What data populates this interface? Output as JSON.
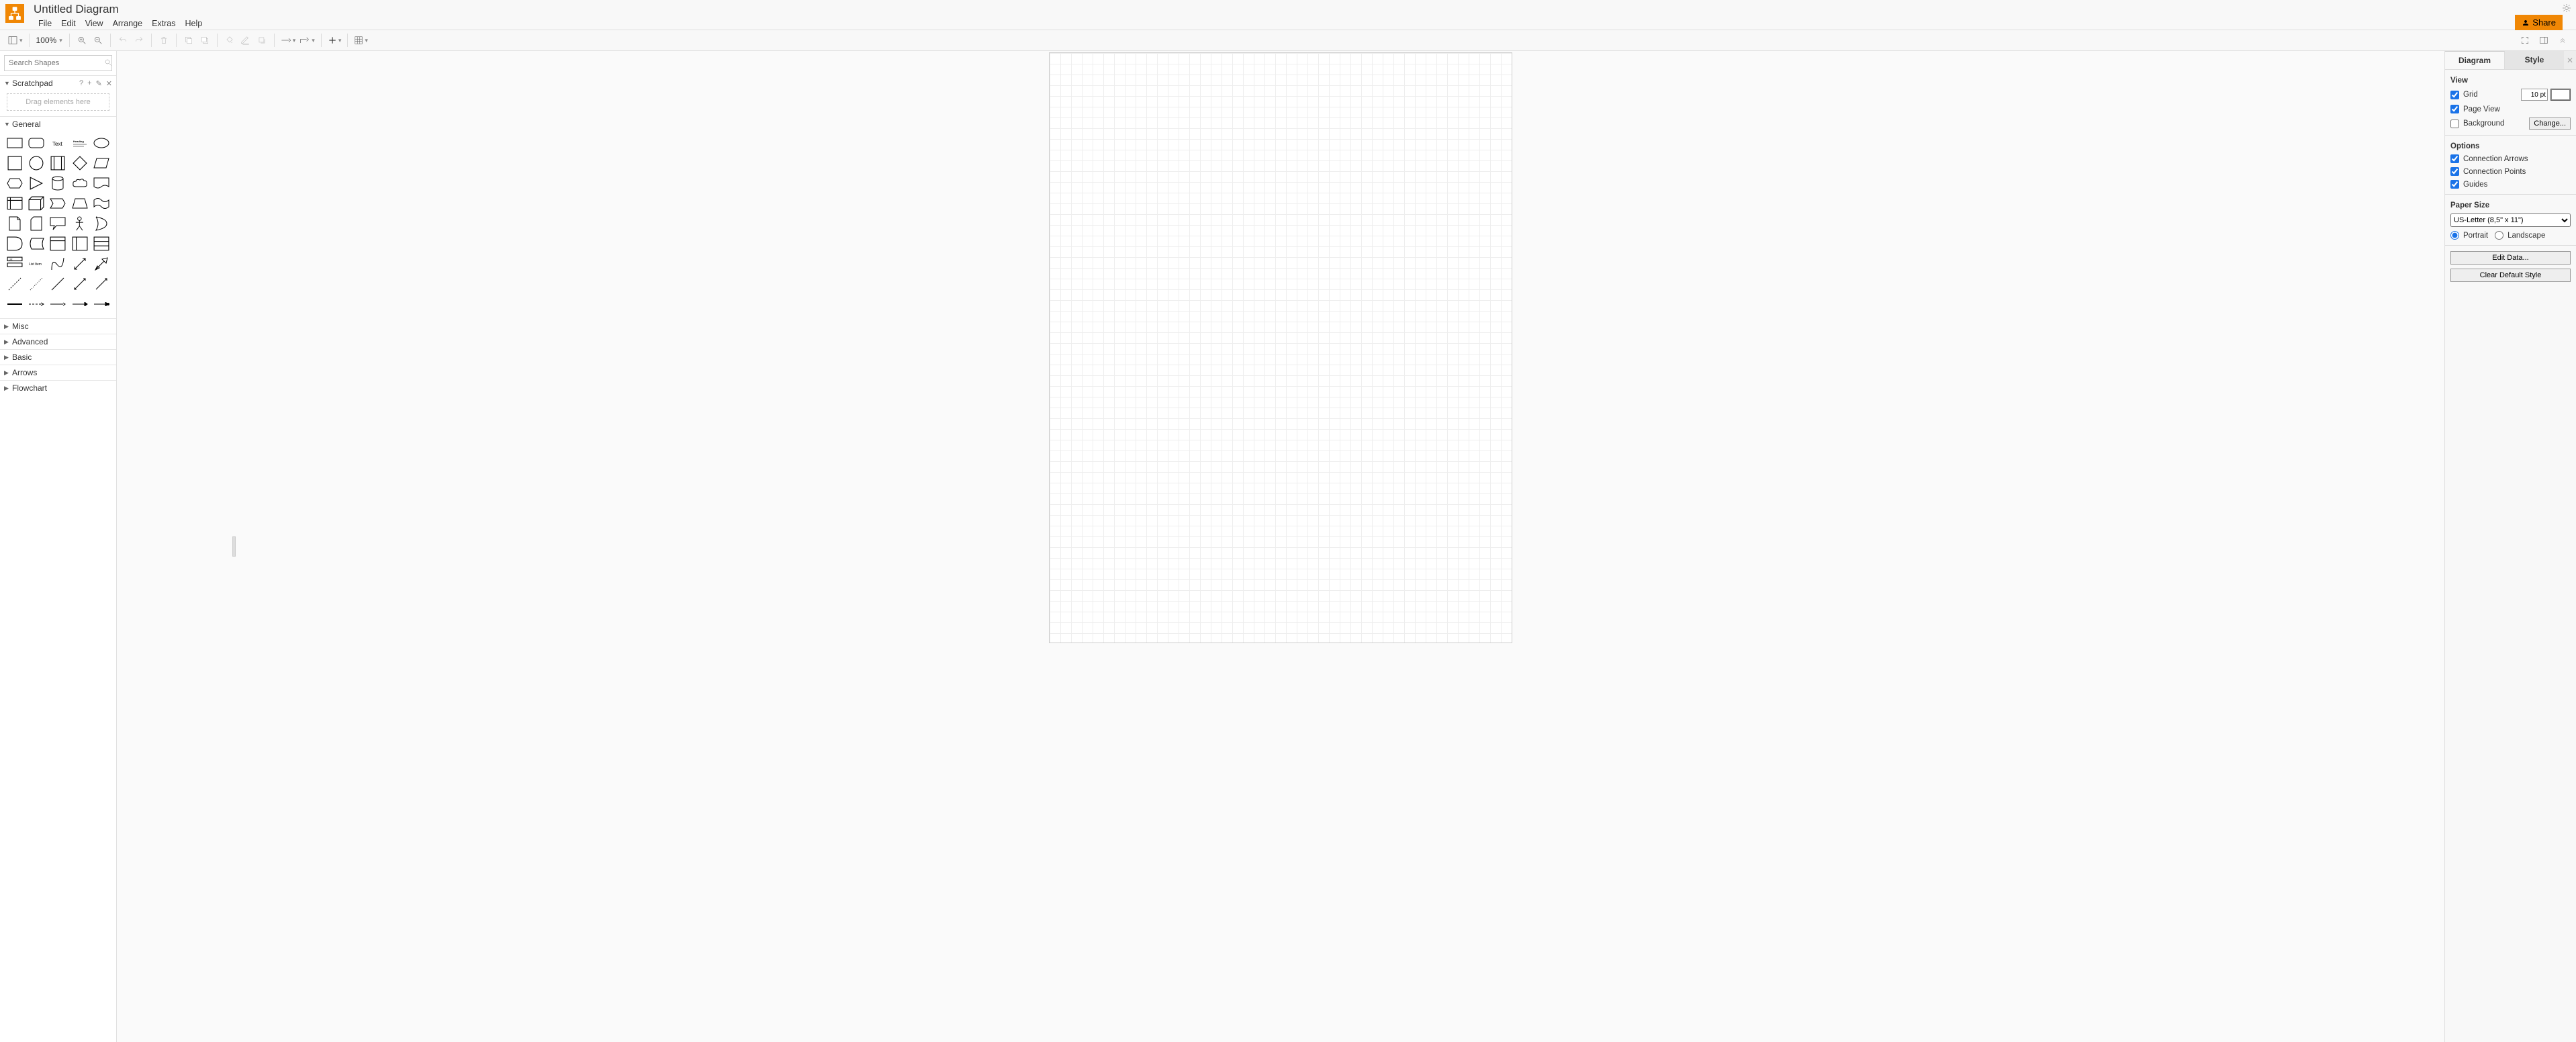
{
  "header": {
    "title": "Untitled Diagram",
    "menus": {
      "file": "File",
      "edit": "Edit",
      "view": "View",
      "arrange": "Arrange",
      "extras": "Extras",
      "help": "Help"
    },
    "share_label": "Share"
  },
  "toolbar": {
    "zoom": "100%"
  },
  "sidebar": {
    "search_placeholder": "Search Shapes",
    "scratchpad": {
      "title": "Scratchpad",
      "drop_hint": "Drag elements here"
    },
    "sections": {
      "general": "General",
      "misc": "Misc",
      "advanced": "Advanced",
      "basic": "Basic",
      "arrows": "Arrows",
      "flowchart": "Flowchart"
    }
  },
  "right": {
    "tabs": {
      "diagram": "Diagram",
      "style": "Style"
    },
    "view": {
      "title": "View",
      "grid": "Grid",
      "grid_size": "10 pt",
      "page_view": "Page View",
      "background": "Background",
      "change_btn": "Change..."
    },
    "options": {
      "title": "Options",
      "connection_arrows": "Connection Arrows",
      "connection_points": "Connection Points",
      "guides": "Guides"
    },
    "paper": {
      "title": "Paper Size",
      "selected": "US-Letter (8,5\" x 11\")",
      "portrait": "Portrait",
      "landscape": "Landscape"
    },
    "buttons": {
      "edit_data": "Edit Data...",
      "clear_style": "Clear Default Style"
    }
  }
}
